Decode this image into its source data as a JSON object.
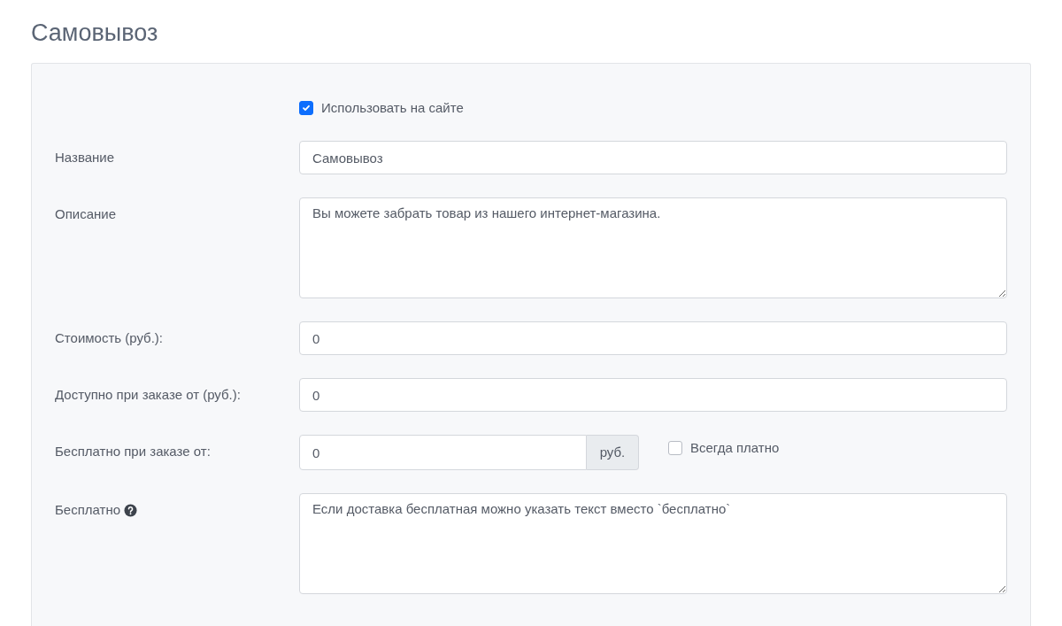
{
  "title": "Самовывоз",
  "use_on_site": {
    "label": "Использовать на сайте",
    "checked": true
  },
  "fields": [
    {
      "kind": "text",
      "label": "Название",
      "value": "Самовывоз"
    },
    {
      "kind": "textarea",
      "label": "Описание",
      "value": "Вы можете забрать товар из нашего интернет-магазина."
    },
    {
      "kind": "text",
      "label": "Стоимость (руб.):",
      "value": "0"
    },
    {
      "kind": "text",
      "label": "Доступно при заказе от (руб.):",
      "value": "0"
    },
    {
      "kind": "addon",
      "label": "Бесплатно при заказе от:",
      "value": "0",
      "addon": "руб.",
      "check": {
        "label": "Всегда платно",
        "checked": false
      }
    },
    {
      "kind": "textarea",
      "label": "Бесплатно",
      "help": true,
      "value": "Если доставка бесплатная можно указать текст вместо `бесплатно`"
    }
  ]
}
